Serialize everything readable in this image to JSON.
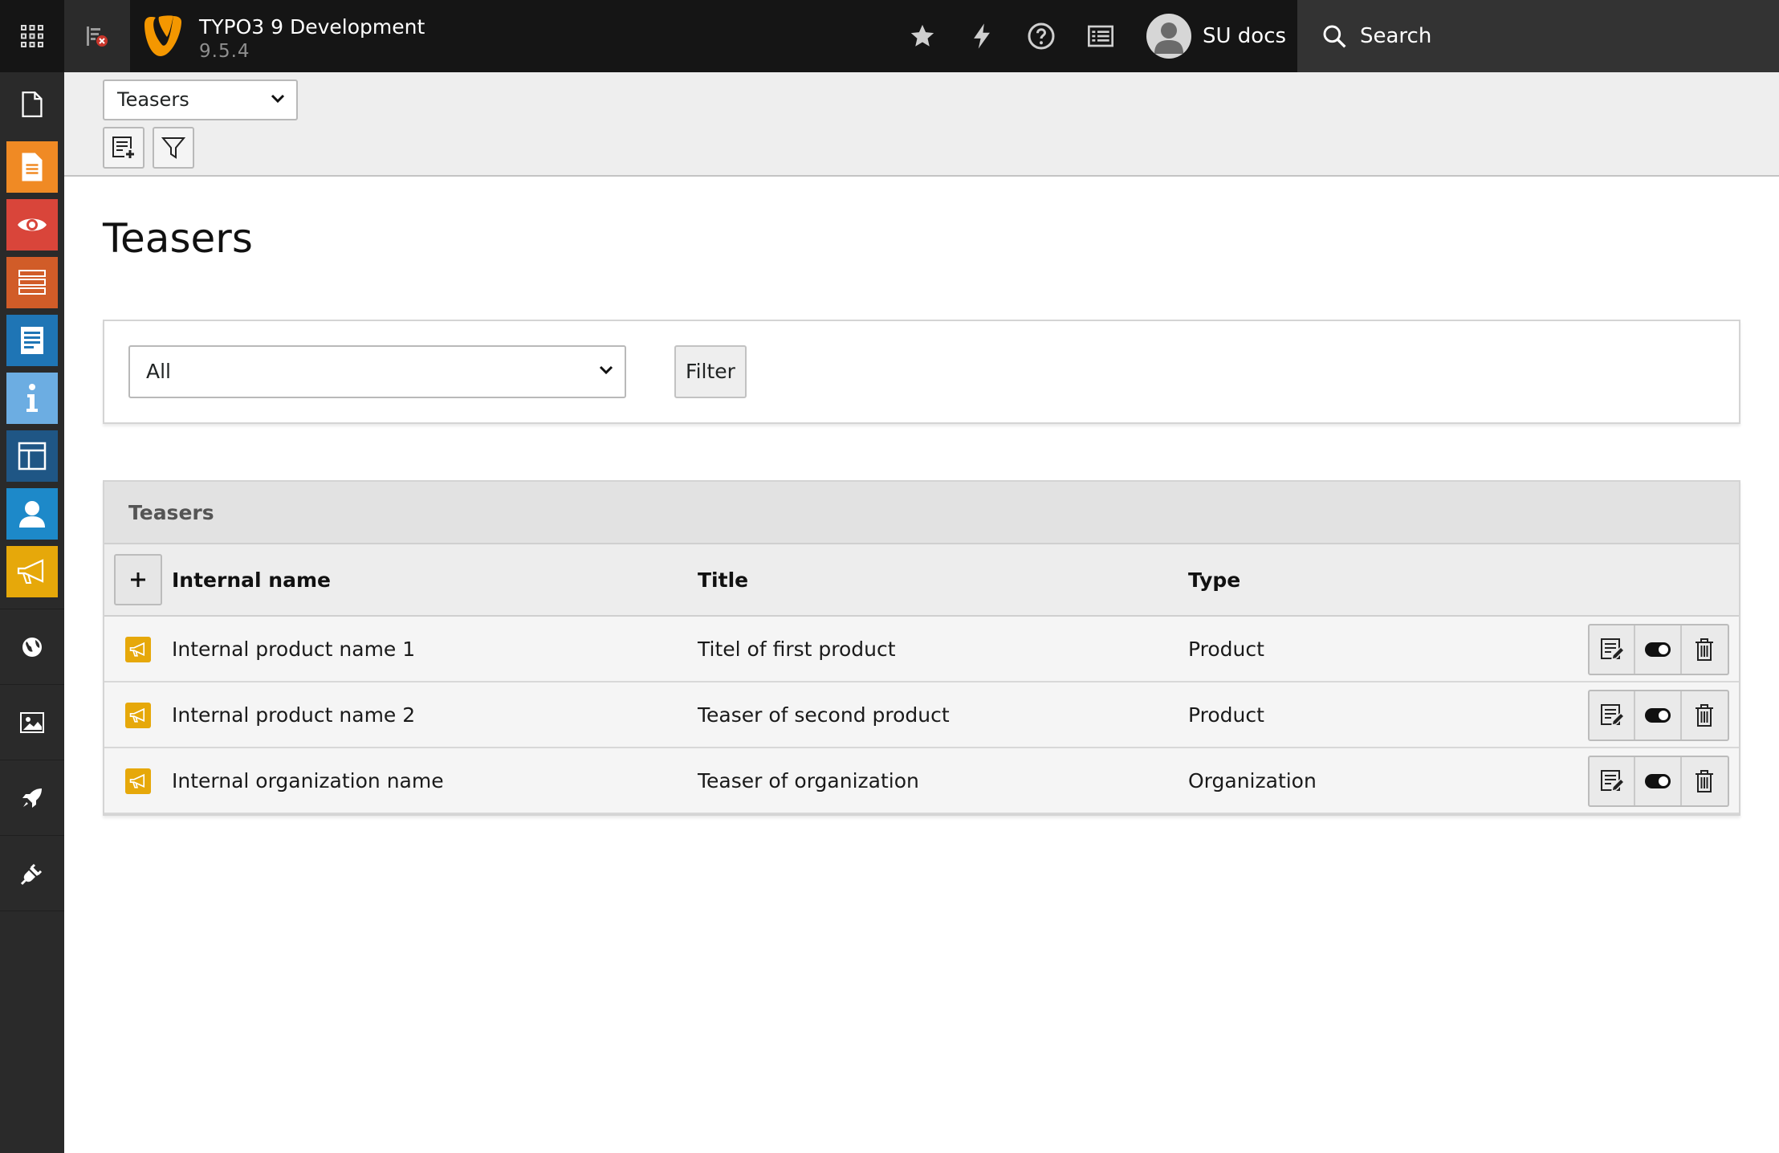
{
  "app": {
    "name": "TYPO3 9 Development",
    "version": "9.5.4"
  },
  "topbar": {
    "user_name": "SU docs",
    "search_label": "Search",
    "icons": [
      "apps-grid-icon",
      "page-tree-toggle-icon",
      "bookmark-star-icon",
      "flush-cache-bolt-icon",
      "help-icon",
      "system-information-icon",
      "user-avatar-icon",
      "search-icon"
    ]
  },
  "sidebar": {
    "modules": [
      {
        "name": "page-module",
        "icon": "document-icon",
        "color": "#2a2a2a"
      },
      {
        "name": "page-content",
        "icon": "page-icon",
        "color": "#f08a24"
      },
      {
        "name": "view",
        "icon": "eye-icon",
        "color": "#d9453a"
      },
      {
        "name": "list",
        "icon": "list-icon",
        "color": "#d15c28"
      },
      {
        "name": "form",
        "icon": "form-icon",
        "color": "#1f75b5"
      },
      {
        "name": "info",
        "icon": "info-icon",
        "color": "#6cade2"
      },
      {
        "name": "template",
        "icon": "layout-icon",
        "color": "#1f5685"
      },
      {
        "name": "users",
        "icon": "user-icon",
        "color": "#1d89c9"
      },
      {
        "name": "teasers",
        "icon": "megaphone-icon",
        "color": "#e6a80a"
      },
      {
        "name": "sites",
        "icon": "globe-icon",
        "color": "#2a2a2a"
      },
      {
        "name": "filelist",
        "icon": "image-icon",
        "color": "#2a2a2a"
      },
      {
        "name": "extensions-launch",
        "icon": "rocket-icon",
        "color": "#2a2a2a"
      },
      {
        "name": "extensions",
        "icon": "plug-icon",
        "color": "#2a2a2a"
      }
    ]
  },
  "docheader": {
    "module_select": "Teasers",
    "buttons": [
      "new-record-icon",
      "filter-icon"
    ]
  },
  "main": {
    "title": "Teasers",
    "filter": {
      "selected": "All",
      "button_label": "Filter"
    },
    "table": {
      "panel_title": "Teasers",
      "columns": [
        "Internal name",
        "Title",
        "Type"
      ],
      "rows": [
        {
          "internal_name": "Internal product name 1",
          "title": "Titel of first product",
          "type": "Product"
        },
        {
          "internal_name": "Internal product name 2",
          "title": "Teaser of second product",
          "type": "Product"
        },
        {
          "internal_name": "Internal organization name",
          "title": "Teaser of organization",
          "type": "Organization"
        }
      ],
      "row_actions": [
        "edit-icon",
        "toggle-visibility-icon",
        "delete-trash-icon"
      ]
    }
  },
  "colors": {
    "typo3_orange": "#f49700",
    "teaser_yellow": "#e6a80a",
    "topbar": "#151515"
  }
}
